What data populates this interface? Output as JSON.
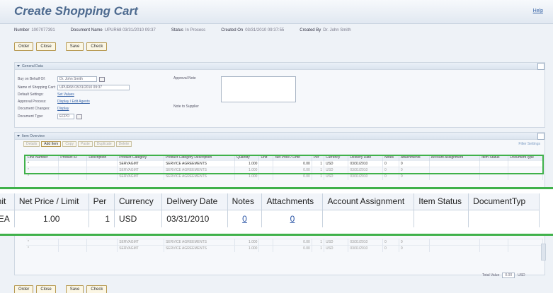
{
  "header": {
    "title": "Create Shopping Cart",
    "help": "Help",
    "fields": [
      {
        "label": "Number",
        "value": "1007077391"
      },
      {
        "label": "Document Name",
        "value": "UPUR68 03/31/2010 09:37"
      },
      {
        "label": "Status",
        "value": "In Process"
      },
      {
        "label": "Created On",
        "value": "03/31/2010 09:37:55"
      },
      {
        "label": "Created By",
        "value": "Dr. John Smith"
      }
    ]
  },
  "buttons": {
    "order": "Order",
    "close": "Close",
    "save": "Save",
    "check": "Check"
  },
  "general": {
    "section_title": "General Data",
    "buy_on_behalf_label": "Buy on Behalf Of:",
    "buy_on_behalf_value": "Dr. John Smith",
    "cart_name_label": "Name of Shopping Cart:",
    "cart_name_value": "UPUR68 03/31/2010 09:37",
    "default_settings_label": "Default Settings:",
    "default_settings_link": "Set Values",
    "approval_process_label": "Approval Process:",
    "approval_process_link": "Display / Edit Agents",
    "document_changes_label": "Document Changes:",
    "document_changes_link": "Display",
    "document_type_label": "Document Type:",
    "document_type_value": "ECPO",
    "approval_note_label": "Approval Note",
    "note_to_supplier_label": "Note to Supplier"
  },
  "items": {
    "section_title": "Item Overview",
    "toolbar": [
      "Details",
      "Add Item",
      "Copy",
      "Paste",
      "Duplicate",
      "Delete"
    ],
    "filter_label": "Filter",
    "settings_label": "Settings",
    "columns": [
      "Line Number",
      "Product ID",
      "Description",
      "Product Category",
      "Product Category Description",
      "Quantity",
      "Unit",
      "Net Price / Limit",
      "Per",
      "Currency",
      "Delivery Date",
      "Notes",
      "Attachments",
      "Account Assignment",
      "Item Status",
      "DocumentType"
    ],
    "rows": [
      {
        "line": "*",
        "category": "SERVAGMT",
        "category_desc": "SERVICE AGREEMENTS",
        "quantity": "1.000",
        "unit": "",
        "price": "0.00",
        "per": "1",
        "currency": "USD",
        "date": "03/31/2010",
        "notes": "0",
        "attachments": "0"
      },
      {
        "line": "*",
        "category": "SERVAGMT",
        "category_desc": "SERVICE AGREEMENTS",
        "quantity": "1.000",
        "unit": "",
        "price": "0.00",
        "per": "1",
        "currency": "USD",
        "date": "03/31/2010",
        "notes": "0",
        "attachments": "0"
      },
      {
        "line": "*",
        "category": "SERVAGMT",
        "category_desc": "SERVICE AGREEMENTS",
        "quantity": "1.000",
        "unit": "",
        "price": "0.00",
        "per": "1",
        "currency": "USD",
        "date": "03/31/2010",
        "notes": "0",
        "attachments": "0"
      }
    ],
    "lower_rows": [
      {
        "line": "*",
        "category": "SERVAGMT",
        "category_desc": "SERVICE AGREEMENTS",
        "quantity": "1.000",
        "price": "0.00",
        "per": "1",
        "currency": "USD",
        "date": "03/31/2010",
        "notes": "0",
        "attachments": "0"
      },
      {
        "line": "*",
        "category": "SERVAGMT",
        "category_desc": "SERVICE AGREEMENTS",
        "quantity": "1.000",
        "price": "0.00",
        "per": "1",
        "currency": "USD",
        "date": "03/31/2010",
        "notes": "0",
        "attachments": "0"
      }
    ],
    "total_label": "Total Value",
    "total_value": "0.00",
    "total_currency": "USD"
  },
  "zoom": {
    "columns": [
      "Unit",
      "Net Price / Limit",
      "Per",
      "Currency",
      "Delivery Date",
      "Notes",
      "Attachments",
      "Account Assignment",
      "Item Status",
      "DocumentTyp"
    ],
    "row": {
      "unit": "EA",
      "price": "1.00",
      "per": "1",
      "currency": "USD",
      "date": "03/31/2010",
      "notes": "0",
      "attachments": "0",
      "account": "",
      "status": "",
      "doctype": ""
    }
  },
  "colors": {
    "highlight": "#3fb14a",
    "title": "#4d6a8f",
    "link": "#3a66a8"
  }
}
